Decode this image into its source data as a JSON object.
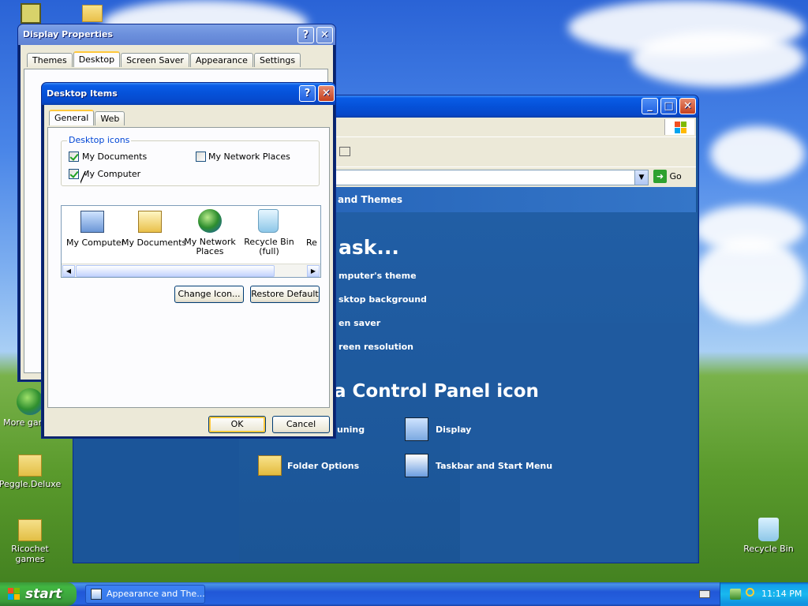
{
  "desktop": {
    "icons": [
      {
        "label": "More games",
        "label2": "games"
      },
      {
        "label": "Peggle.Deluxe"
      },
      {
        "label": "Ricochet games"
      },
      {
        "label": "Recycle Bin"
      }
    ]
  },
  "display_properties": {
    "title": "Display Properties",
    "tabs": [
      "Themes",
      "Desktop",
      "Screen Saver",
      "Appearance",
      "Settings"
    ]
  },
  "control_panel": {
    "go_label": "Go",
    "category_title": "and Themes",
    "pick_task": "ask...",
    "tasks": [
      "mputer's theme",
      "sktop background",
      "en saver",
      "reen resolution"
    ],
    "pick_icon": "a Control Panel icon",
    "icons": [
      "uning",
      "Display",
      "Folder Options",
      "Taskbar and Start Menu"
    ]
  },
  "desktop_items": {
    "title": "Desktop Items",
    "tabs": [
      "General",
      "Web"
    ],
    "group_label": "Desktop icons",
    "checkboxes": [
      {
        "label": "My Documents",
        "checked": true
      },
      {
        "label": "My Network Places",
        "checked": false
      },
      {
        "label": "My Computer",
        "checked": true
      }
    ],
    "icons": [
      {
        "label": "My Computer"
      },
      {
        "label": "My Documents"
      },
      {
        "label": "My Network Places"
      },
      {
        "label": "Recycle Bin (full)"
      },
      {
        "label": "Re"
      }
    ],
    "change_icon_label": "Change Icon...",
    "restore_default_label": "Restore Default",
    "ok_label": "OK",
    "cancel_label": "Cancel"
  },
  "taskbar": {
    "start_label": "start",
    "task_item_label": "Appearance and The...",
    "clock": "11:14 PM"
  }
}
